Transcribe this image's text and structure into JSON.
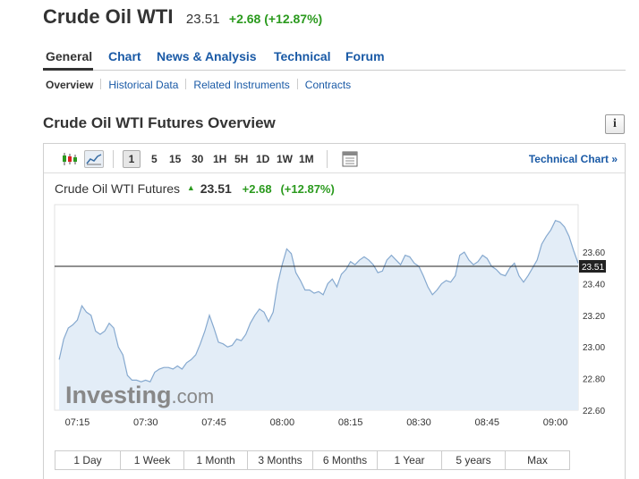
{
  "header": {
    "name": "Crude Oil WTI",
    "price": "23.51",
    "change": "+2.68 (+12.87%)"
  },
  "main_tabs": [
    "General",
    "Chart",
    "News & Analysis",
    "Technical",
    "Forum"
  ],
  "sub_tabs": [
    "Overview",
    "Historical Data",
    "Related Instruments",
    "Contracts"
  ],
  "section_title": "Crude Oil WTI Futures Overview",
  "info_button": "i",
  "toolbar": {
    "intervals": [
      "1",
      "5",
      "15",
      "30",
      "1H",
      "5H",
      "1D",
      "1W",
      "1M"
    ],
    "selected_interval": "1",
    "technical_chart": "Technical Chart »",
    "icons": [
      "candlestick-icon",
      "area-chart-icon",
      "table-icon"
    ]
  },
  "quote": {
    "name": "Crude Oil WTI Futures",
    "price": "23.51",
    "change": "+2.68",
    "change_pct": "(+12.87%)",
    "color_up": "#2b9a1e"
  },
  "watermark": {
    "brand": "Investing",
    "suffix": ".com"
  },
  "ranges": [
    "1 Day",
    "1 Week",
    "1 Month",
    "3 Months",
    "6 Months",
    "1 Year",
    "5 years",
    "Max"
  ],
  "chart_data": {
    "type": "area",
    "x_tick_labels": [
      "07:15",
      "07:30",
      "07:45",
      "08:00",
      "08:15",
      "08:30",
      "08:45",
      "09:00"
    ],
    "y_tick_labels": [
      "23.60",
      "23.40",
      "23.20",
      "23.00",
      "22.80",
      "22.60"
    ],
    "ylim": [
      22.6,
      23.9
    ],
    "last_price": 23.51,
    "last_price_label": "23.51",
    "series": [
      {
        "x": [
          "07:11",
          "07:12",
          "07:13",
          "07:14",
          "07:15",
          "07:16",
          "07:17",
          "07:18",
          "07:19",
          "07:20",
          "07:21",
          "07:22",
          "07:23",
          "07:24",
          "07:25",
          "07:26",
          "07:27",
          "07:28",
          "07:29",
          "07:30",
          "07:31",
          "07:32",
          "07:33",
          "07:34",
          "07:35",
          "07:36",
          "07:37",
          "07:38",
          "07:39",
          "07:40",
          "07:41",
          "07:42",
          "07:43",
          "07:44",
          "07:45",
          "07:46",
          "07:47",
          "07:48",
          "07:49",
          "07:50",
          "07:51",
          "07:52",
          "07:53",
          "07:54",
          "07:55",
          "07:56",
          "07:57",
          "07:58",
          "07:59",
          "08:00",
          "08:01",
          "08:02",
          "08:03",
          "08:04",
          "08:05",
          "08:06",
          "08:07",
          "08:08",
          "08:09",
          "08:10",
          "08:11",
          "08:12",
          "08:13",
          "08:14",
          "08:15",
          "08:16",
          "08:17",
          "08:18",
          "08:19",
          "08:20",
          "08:21",
          "08:22",
          "08:23",
          "08:24",
          "08:25",
          "08:26",
          "08:27",
          "08:28",
          "08:29",
          "08:30",
          "08:31",
          "08:32",
          "08:33",
          "08:34",
          "08:35",
          "08:36",
          "08:37",
          "08:38",
          "08:39",
          "08:40",
          "08:41",
          "08:42",
          "08:43",
          "08:44",
          "08:45",
          "08:46",
          "08:47",
          "08:48",
          "08:49",
          "08:50",
          "08:51",
          "08:52",
          "08:53",
          "08:54",
          "08:55",
          "08:56",
          "08:57",
          "08:58",
          "08:59",
          "09:00",
          "09:01",
          "09:02",
          "09:03",
          "09:04",
          "09:05"
        ],
        "y": [
          22.92,
          23.05,
          23.12,
          23.14,
          23.17,
          23.26,
          23.22,
          23.2,
          23.1,
          23.08,
          23.1,
          23.15,
          23.12,
          23.0,
          22.95,
          22.82,
          22.79,
          22.79,
          22.78,
          22.79,
          22.78,
          22.84,
          22.86,
          22.87,
          22.87,
          22.86,
          22.88,
          22.86,
          22.9,
          22.92,
          22.95,
          23.02,
          23.1,
          23.2,
          23.12,
          23.03,
          23.02,
          23.0,
          23.01,
          23.05,
          23.04,
          23.08,
          23.15,
          23.2,
          23.24,
          23.22,
          23.16,
          23.22,
          23.4,
          23.52,
          23.62,
          23.59,
          23.47,
          23.42,
          23.36,
          23.36,
          23.34,
          23.35,
          23.33,
          23.4,
          23.43,
          23.38,
          23.46,
          23.49,
          23.54,
          23.52,
          23.55,
          23.57,
          23.55,
          23.52,
          23.47,
          23.48,
          23.55,
          23.58,
          23.55,
          23.52,
          23.58,
          23.57,
          23.53,
          23.51,
          23.45,
          23.38,
          23.33,
          23.36,
          23.4,
          23.42,
          23.41,
          23.45,
          23.58,
          23.6,
          23.55,
          23.52,
          23.54,
          23.58,
          23.56,
          23.51,
          23.49,
          23.46,
          23.45,
          23.5,
          23.53,
          23.45,
          23.41,
          23.45,
          23.5,
          23.55,
          23.65,
          23.7,
          23.74,
          23.8,
          23.79,
          23.76,
          23.7,
          23.61,
          23.53
        ]
      }
    ]
  }
}
